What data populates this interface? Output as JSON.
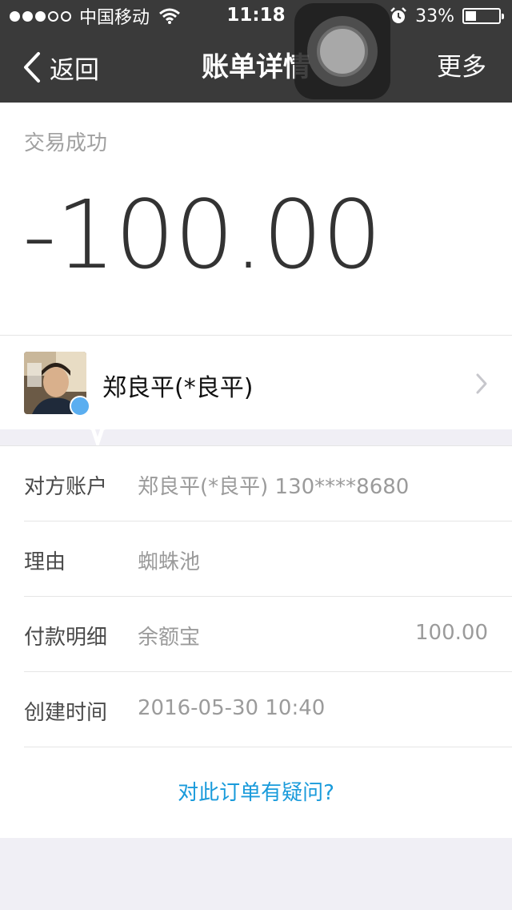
{
  "status_bar": {
    "carrier": "中国移动",
    "time": "11:18",
    "battery": "33%",
    "battery_level": 0.33,
    "signal_bars_filled": 3,
    "signal_bars_total": 5
  },
  "nav": {
    "back_label": "返回",
    "title": "账单详情",
    "more_label": "更多"
  },
  "summary": {
    "status": "交易成功",
    "amount": "-100.00"
  },
  "payee": {
    "name": "郑良平(*良平)"
  },
  "details": [
    {
      "label": "对方账户",
      "value": "郑良平(*良平) 130****8680",
      "amount": ""
    },
    {
      "label": "理由",
      "value": "蜘蛛池",
      "amount": ""
    },
    {
      "label": "付款明细",
      "value": "余额宝",
      "amount": "100.00"
    },
    {
      "label": "创建时间",
      "value": "2016-05-30 10:40",
      "amount": ""
    }
  ],
  "question_link": "对此订单有疑问?",
  "colors": {
    "navbar": "#3a3a3a",
    "link": "#1a9bdb",
    "background": "#f0eff5"
  }
}
